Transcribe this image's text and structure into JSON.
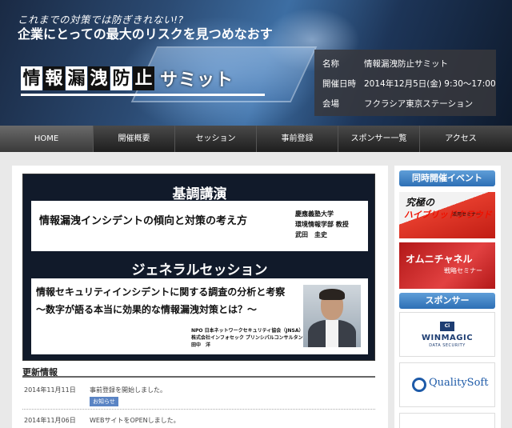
{
  "header": {
    "tagline1": "これまでの対策では防ぎきれない!?",
    "tagline2": "企業にとっての最大のリスクを見つめなおす",
    "logo_chars": [
      "情",
      "報",
      "漏",
      "洩",
      "防",
      "止"
    ],
    "logo_kana": "サミット",
    "info": [
      {
        "key": "名称",
        "value": "情報漏洩防止サミット"
      },
      {
        "key": "開催日時",
        "value": "2014年12月5日(金) 9:30～17:00"
      },
      {
        "key": "会場",
        "value": "フクラシア東京ステーション"
      }
    ]
  },
  "nav": {
    "items": [
      "HOME",
      "開催概要",
      "セッション",
      "事前登録",
      "スポンサー一覧",
      "アクセス"
    ],
    "active": "HOME"
  },
  "banner": {
    "keynote_heading": "基調講演",
    "keynote_title": "情報漏洩インシデントの傾向と対策の考え方",
    "keynote_speaker": [
      "慶應義塾大学",
      "環境情報学部 教授",
      "武田　圭史"
    ],
    "general_heading": "ジェネラルセッション",
    "general_title": [
      "情報セキュリティインシデントに関する調査の分析と考察",
      "～数字が語る本当に効果的な情報漏洩対策とは？～"
    ],
    "general_speaker": [
      "NPO 日本ネットワークセキュリティ協会（JNSA）",
      "株式会社インフォセック プリンシパルコンサルタント",
      "田中　洋"
    ]
  },
  "updates": {
    "heading": "更新情報",
    "items": [
      {
        "date": "2014年11月11日",
        "text": "事前登録を開始しました。",
        "badge": "お知らせ"
      },
      {
        "date": "2014年11月06日",
        "text": "WEBサイトをOPENしました。"
      }
    ]
  },
  "sidebar": {
    "events_heading": "同時開催イベント",
    "banner1": {
      "line1": "究極の",
      "line2": "ハイブリッドクラウド",
      "line3": "活用セミナー"
    },
    "banner2": {
      "line1": "オムニチャネル",
      "line2": "戦略セミナー"
    },
    "sponsor_heading": "スポンサー",
    "winmagic": {
      "icon": "Ci",
      "name": "WINMAGIC",
      "sub": "DATA SECURITY"
    },
    "quality": {
      "name": "QualitySoft"
    }
  }
}
